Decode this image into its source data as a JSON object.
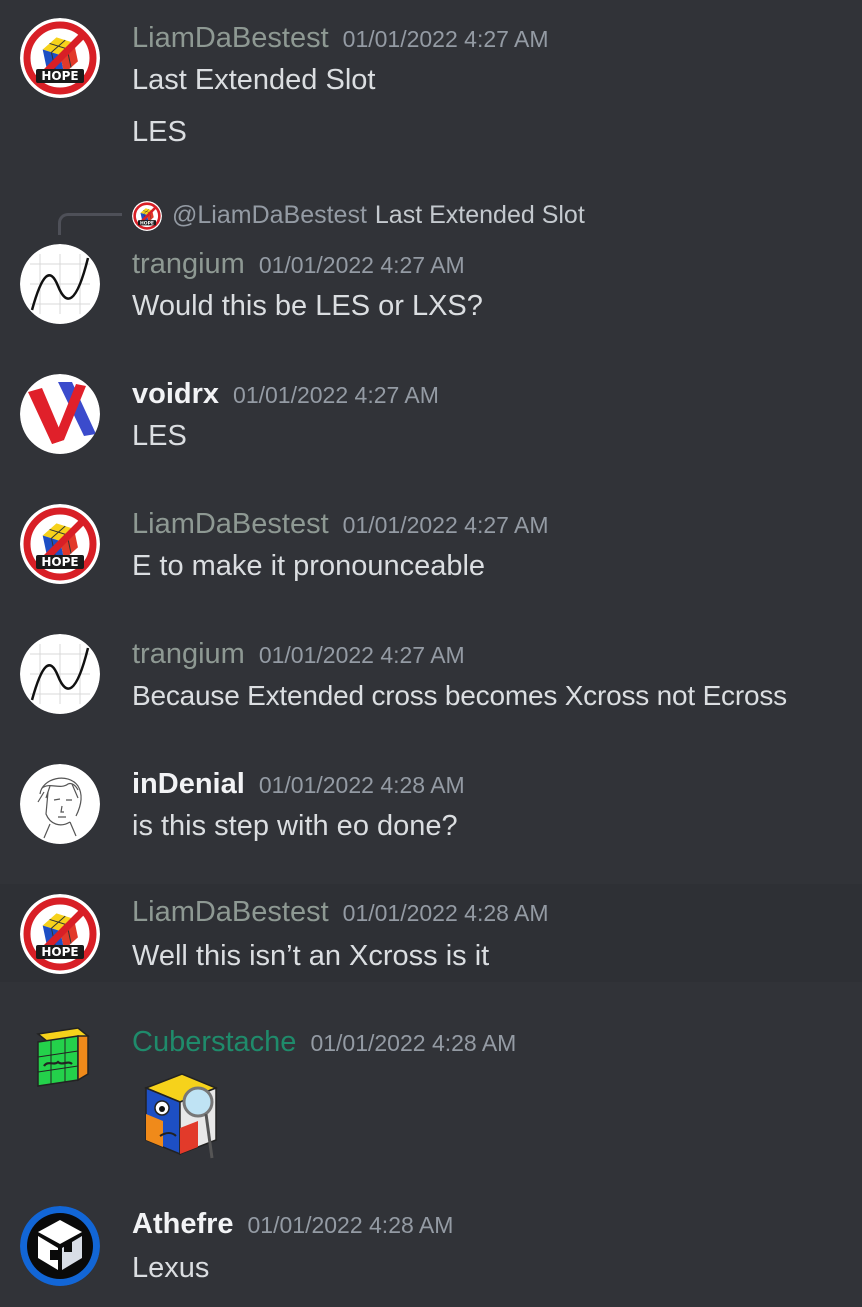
{
  "colors": {
    "background": "#313338",
    "highlight_row": "#2e3035",
    "timestamp": "#949ba4",
    "text": "#dbdee1",
    "name_gray": "#8e9993",
    "name_green": "#1f8b6b",
    "name_white": "#f2f3f5"
  },
  "reply": {
    "mention": "@LiamDaBestest",
    "content": "Last Extended Slot"
  },
  "messages": [
    {
      "author": "LiamDaBestest",
      "timestamp": "01/01/2022 4:27 AM",
      "lines": [
        "Last Extended Slot",
        "LES"
      ],
      "avatar": "hope-cube-avatar"
    },
    {
      "author": "trangium",
      "timestamp": "01/01/2022 4:27 AM",
      "lines": [
        "Would this be LES or LXS?"
      ],
      "avatar": "graph-curve-avatar"
    },
    {
      "author": "voidrx",
      "timestamp": "01/01/2022 4:27 AM",
      "lines": [
        "LES"
      ],
      "avatar": "v-logo-avatar"
    },
    {
      "author": "LiamDaBestest",
      "timestamp": "01/01/2022 4:27 AM",
      "lines": [
        "E to make it pronounceable"
      ],
      "avatar": "hope-cube-avatar"
    },
    {
      "author": "trangium",
      "timestamp": "01/01/2022 4:27 AM",
      "lines": [
        "Because Extended cross becomes Xcross not Ecross"
      ],
      "avatar": "graph-curve-avatar"
    },
    {
      "author": "inDenial",
      "timestamp": "01/01/2022 4:28 AM",
      "lines": [
        "is this step with eo done?"
      ],
      "avatar": "sketch-portrait-avatar"
    },
    {
      "author": "LiamDaBestest",
      "timestamp": "01/01/2022 4:28 AM",
      "lines": [
        "Well this isn’t an Xcross is it"
      ],
      "avatar": "hope-cube-avatar"
    },
    {
      "author": "Cuberstache",
      "timestamp": "01/01/2022 4:28 AM",
      "lines": [],
      "emoji": "cube-magnifier-emoji",
      "avatar": "mustache-cube-avatar"
    },
    {
      "author": "Athefre",
      "timestamp": "01/01/2022 4:28 AM",
      "lines": [
        "Lexus"
      ],
      "avatar": "blue-cube-logo-avatar"
    }
  ]
}
